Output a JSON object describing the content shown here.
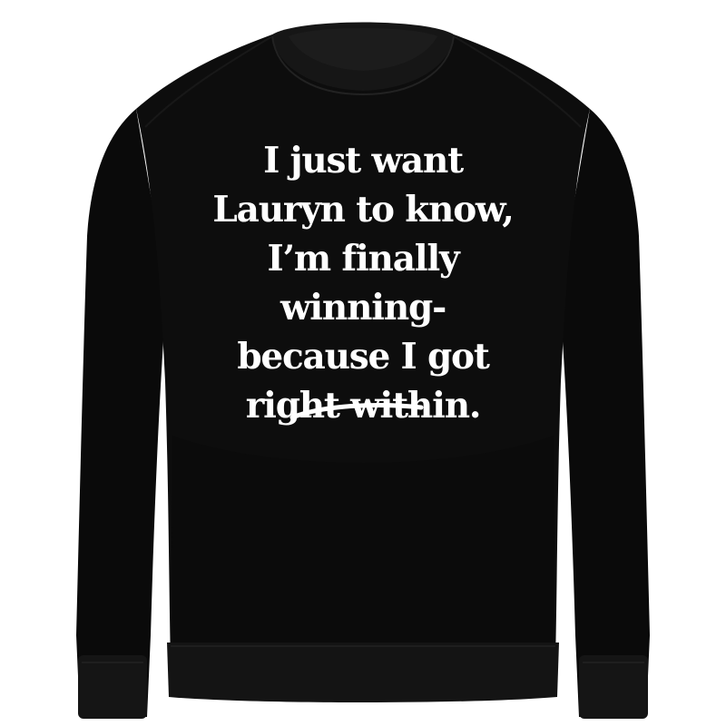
{
  "image": {
    "subject": "black crewneck sweatshirt with white printed text",
    "background_color": "#ffffff",
    "garment_color": "#0d0d0d",
    "print_color": "#ffffff"
  },
  "print": {
    "lines": [
      "I just want",
      "Lauryn to know,",
      "I’m finally",
      "winning-",
      "because I got",
      "right within."
    ],
    "decoration": "hand-drawn underline swoosh"
  }
}
